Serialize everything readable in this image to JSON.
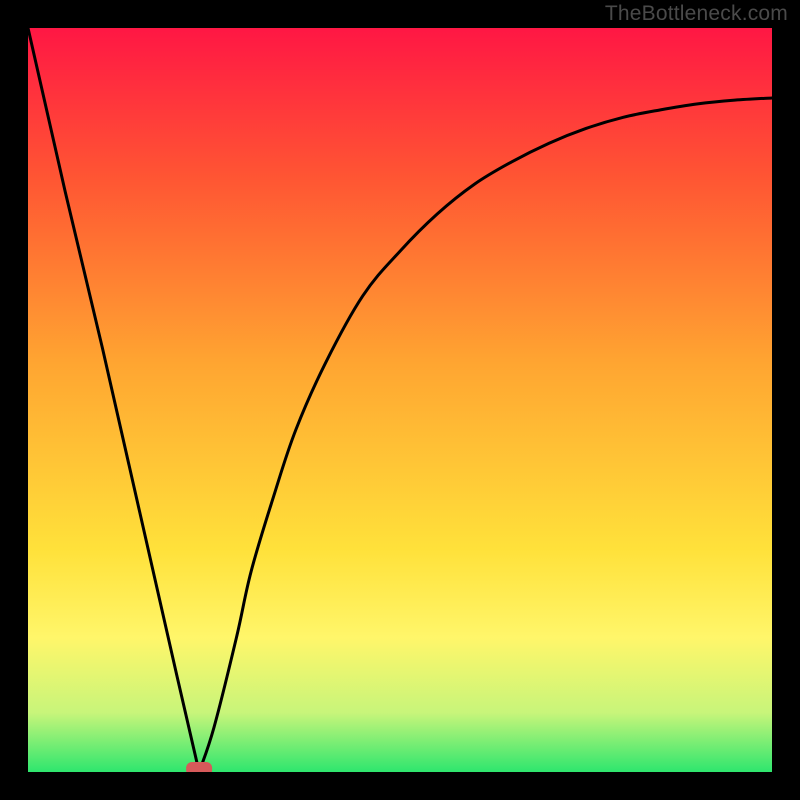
{
  "watermark": "TheBottleneck.com",
  "chart_data": {
    "type": "line",
    "title": "",
    "xlabel": "",
    "ylabel": "",
    "xlim": [
      0,
      100
    ],
    "ylim": [
      0,
      100
    ],
    "grid": false,
    "legend": false,
    "background": {
      "description": "vertical gradient red→orange→yellow→green representing bottleneck severity (red high, green low)",
      "stops": [
        {
          "offset": 0.0,
          "color": "#ff1744"
        },
        {
          "offset": 0.2,
          "color": "#ff5533"
        },
        {
          "offset": 0.45,
          "color": "#ffa531"
        },
        {
          "offset": 0.7,
          "color": "#ffe13a"
        },
        {
          "offset": 0.82,
          "color": "#fff66a"
        },
        {
          "offset": 0.92,
          "color": "#c8f57a"
        },
        {
          "offset": 1.0,
          "color": "#2ee66e"
        }
      ]
    },
    "series": [
      {
        "name": "bottleneck-curve",
        "description": "V-shaped bottleneck curve; left branch linear descent, right branch asymptotic rise",
        "x": [
          0,
          5,
          10,
          15,
          20,
          23,
          25,
          28,
          30,
          33,
          36,
          40,
          45,
          50,
          55,
          60,
          65,
          70,
          75,
          80,
          85,
          90,
          95,
          100
        ],
        "y": [
          100,
          78,
          57,
          35,
          13,
          0,
          6,
          18,
          27,
          37,
          46,
          55,
          64,
          70,
          75,
          79,
          82,
          84.5,
          86.5,
          88,
          89,
          89.8,
          90.3,
          90.6
        ]
      }
    ],
    "marker": {
      "name": "optimal-point",
      "x": 23,
      "y": 0,
      "shape": "rounded-rect",
      "color": "#d65a5a"
    }
  }
}
